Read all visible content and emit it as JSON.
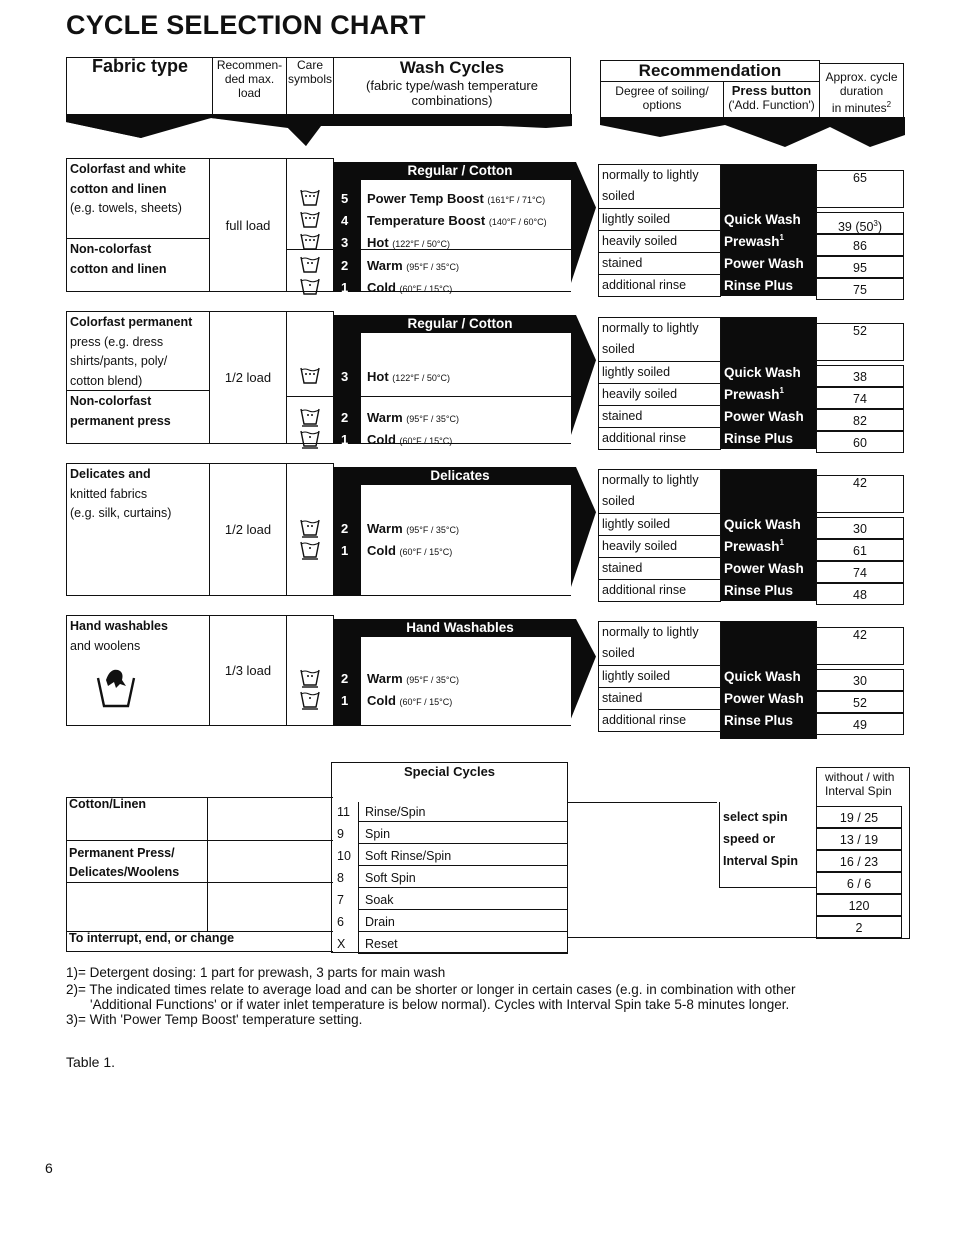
{
  "page": {
    "title": "CYCLE SELECTION CHART",
    "page_number": "6",
    "caption": "Table 1."
  },
  "header": {
    "fabric_type": "Fabric type",
    "load": [
      "Recommen-",
      "ded max.",
      "load"
    ],
    "care": [
      "Care",
      "symbols"
    ],
    "wash_cycles": "Wash Cycles",
    "wash_cycles_sub": [
      "(fabric type/wash temperature",
      "combinations)"
    ],
    "recommendation": "Recommendation",
    "soiling": [
      "Degree of soiling/",
      "options"
    ],
    "press_button": [
      "Press button",
      "('Add. Function')"
    ],
    "duration": [
      "Approx. cycle",
      "duration",
      "in minutes"
    ],
    "duration_sup": "2"
  },
  "sections": [
    {
      "fabrics": [
        {
          "bold": "Colorfast and white",
          "lines": [
            "cotton and linen",
            "(e.g. towels, sheets)"
          ]
        },
        {
          "bold": "Non-colorfast",
          "lines": [
            "cotton and linen"
          ]
        }
      ],
      "load": "full load",
      "program": "Regular / Cotton",
      "cycles": [
        {
          "num": "5",
          "name": "Power Temp Boost",
          "temp": "(161°F / 71°C)"
        },
        {
          "num": "4",
          "name": "Temperature Boost",
          "temp": "(140°F / 60°C)"
        },
        {
          "num": "3",
          "name": "Hot",
          "temp": "(122°F / 50°C)"
        },
        {
          "num": "2",
          "name": "Warm",
          "temp": "(95°F / 35°C)"
        },
        {
          "num": "1",
          "name": "Cold",
          "temp": "(60°F / 15°C)"
        }
      ],
      "options": [
        {
          "soiling": [
            "normally to lightly",
            "soiled"
          ],
          "button": "",
          "minutes": "65"
        },
        {
          "soiling": [
            "lightly soiled"
          ],
          "button": "Quick Wash",
          "minutes": "39 (50",
          "sup": "3",
          "after": ")"
        },
        {
          "soiling": [
            "heavily soiled"
          ],
          "button": "Prewash",
          "button_sup": "1",
          "minutes": "86"
        },
        {
          "soiling": [
            "stained"
          ],
          "button": "Power Wash",
          "minutes": "95"
        },
        {
          "soiling": [
            "additional rinse"
          ],
          "button": "Rinse Plus",
          "minutes": "75"
        }
      ]
    },
    {
      "fabrics": [
        {
          "bold": "Colorfast permanent",
          "lines": [
            "press (e.g. dress",
            "shirts/pants, poly/",
            "cotton blend)"
          ]
        },
        {
          "bold": "Non-colorfast",
          "lines": [
            "permanent press"
          ]
        }
      ],
      "load": "1/2 load",
      "program": "Regular / Cotton",
      "cycles": [
        {
          "num": "3",
          "name": "Hot",
          "temp": "(122°F / 50°C)"
        },
        {
          "num": "2",
          "name": "Warm",
          "temp": "(95°F / 35°C)"
        },
        {
          "num": "1",
          "name": "Cold",
          "temp": "(60°F / 15°C)"
        }
      ],
      "options": [
        {
          "soiling": [
            "normally to lightly",
            "soiled"
          ],
          "button": "",
          "minutes": "52"
        },
        {
          "soiling": [
            "lightly soiled"
          ],
          "button": "Quick Wash",
          "minutes": "38"
        },
        {
          "soiling": [
            "heavily soiled"
          ],
          "button": "Prewash",
          "button_sup": "1",
          "minutes": "74"
        },
        {
          "soiling": [
            "stained"
          ],
          "button": "Power Wash",
          "minutes": "82"
        },
        {
          "soiling": [
            "additional rinse"
          ],
          "button": "Rinse Plus",
          "minutes": "60"
        }
      ]
    },
    {
      "fabrics": [
        {
          "bold": "Delicates and",
          "lines": [
            "knitted fabrics",
            "(e.g. silk, curtains)"
          ]
        }
      ],
      "load": "1/2 load",
      "program": "Delicates",
      "cycles": [
        {
          "num": "2",
          "name": "Warm",
          "temp": "(95°F / 35°C)"
        },
        {
          "num": "1",
          "name": "Cold",
          "temp": "(60°F / 15°C)"
        }
      ],
      "options": [
        {
          "soiling": [
            "normally to lightly",
            "soiled"
          ],
          "button": "",
          "minutes": "42"
        },
        {
          "soiling": [
            "lightly soiled"
          ],
          "button": "Quick Wash",
          "minutes": "30"
        },
        {
          "soiling": [
            "heavily soiled"
          ],
          "button": "Prewash",
          "button_sup": "1",
          "minutes": "61"
        },
        {
          "soiling": [
            "stained"
          ],
          "button": "Power Wash",
          "minutes": "74"
        },
        {
          "soiling": [
            "additional rinse"
          ],
          "button": "Rinse Plus",
          "minutes": "48"
        }
      ]
    },
    {
      "fabrics": [
        {
          "bold": "Hand washables",
          "lines": [
            "and woolens"
          ]
        }
      ],
      "load": "1/3 load",
      "program": "Hand Washables",
      "cycles": [
        {
          "num": "2",
          "name": "Warm",
          "temp": "(95°F / 35°C)"
        },
        {
          "num": "1",
          "name": "Cold",
          "temp": "(60°F / 15°C)"
        }
      ],
      "options": [
        {
          "soiling": [
            "normally to lightly",
            "soiled"
          ],
          "button": "",
          "minutes": "42"
        },
        {
          "soiling": [
            "lightly soiled"
          ],
          "button": "Quick Wash",
          "minutes": "30"
        },
        {
          "soiling": [
            "stained"
          ],
          "button": "Power Wash",
          "minutes": "52"
        },
        {
          "soiling": [
            "additional rinse"
          ],
          "button": "Rinse Plus",
          "minutes": "49"
        }
      ]
    }
  ],
  "special": {
    "title": "Special Cycles",
    "duration_header": [
      "without / with",
      "Interval Spin"
    ],
    "groups": [
      "Cotton/Linen",
      "Permanent Press/",
      "Delicates/Woolens",
      "To interrupt, end, or change"
    ],
    "rows": [
      {
        "num": "11",
        "name": "Rinse/Spin",
        "minutes": "19 / 25"
      },
      {
        "num": "9",
        "name": "Spin",
        "minutes": "13 / 19"
      },
      {
        "num": "10",
        "name": "Soft Rinse/Spin",
        "minutes": "16 / 23"
      },
      {
        "num": "8",
        "name": "Soft Spin",
        "minutes": "6 / 6"
      },
      {
        "num": "7",
        "name": "Soak",
        "minutes": "120"
      },
      {
        "num": "6",
        "name": "Drain",
        "minutes": "2"
      },
      {
        "num": "X",
        "name": "Reset",
        "minutes": ""
      }
    ],
    "spin_note": [
      "select spin",
      "speed or",
      "Interval Spin"
    ]
  },
  "footnotes": [
    "1)= Detergent dosing: 1 part for prewash, 3 parts for main wash",
    "2)= The indicated times relate to average load and can be shorter or longer in certain cases (e.g. in combination with other",
    "'Additional Functions' or if water inlet temperature is below normal). Cycles with Interval Spin take 5-8 minutes longer.",
    "3)= With 'Power Temp Boost' temperature setting."
  ],
  "icons": {
    "care_symbol": "wash-tub-icon",
    "hand_wash": "hand-wash-icon"
  }
}
